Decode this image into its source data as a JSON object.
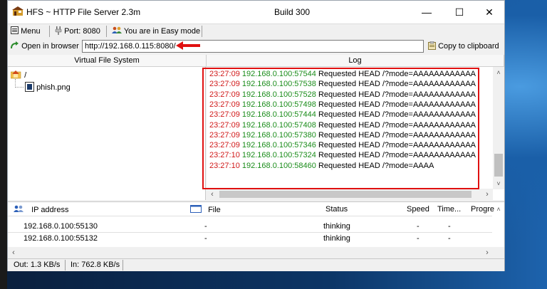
{
  "window": {
    "title": "HFS ~ HTTP File Server 2.3m",
    "build": "Build 300",
    "minimize": "—",
    "maximize": "☐",
    "close": "✕"
  },
  "toolbar": {
    "menu_label": "Menu",
    "port_label": "Port: 8080",
    "mode_label": "You are in Easy mode",
    "open_browser_label": "Open in browser",
    "url_value": "http://192.168.0.115:8080/",
    "copy_label": "Copy to clipboard"
  },
  "vfs": {
    "header": "Virtual File System",
    "root_label": "/",
    "file_label": "phish.png"
  },
  "log": {
    "header": "Log",
    "entries": [
      {
        "time": "23:27:09",
        "ip": "192.168.0.100:57544",
        "msg": "Requested HEAD /?mode=AAAAAAAAAAAA"
      },
      {
        "time": "23:27:09",
        "ip": "192.168.0.100:57538",
        "msg": "Requested HEAD /?mode=AAAAAAAAAAAA"
      },
      {
        "time": "23:27:09",
        "ip": "192.168.0.100:57528",
        "msg": "Requested HEAD /?mode=AAAAAAAAAAAA"
      },
      {
        "time": "23:27:09",
        "ip": "192.168.0.100:57498",
        "msg": "Requested HEAD /?mode=AAAAAAAAAAAA"
      },
      {
        "time": "23:27:09",
        "ip": "192.168.0.100:57444",
        "msg": "Requested HEAD /?mode=AAAAAAAAAAAA"
      },
      {
        "time": "23:27:09",
        "ip": "192.168.0.100:57408",
        "msg": "Requested HEAD /?mode=AAAAAAAAAAAA"
      },
      {
        "time": "23:27:09",
        "ip": "192.168.0.100:57380",
        "msg": "Requested HEAD /?mode=AAAAAAAAAAAA"
      },
      {
        "time": "23:27:09",
        "ip": "192.168.0.100:57346",
        "msg": "Requested HEAD /?mode=AAAAAAAAAAAA"
      },
      {
        "time": "23:27:10",
        "ip": "192.168.0.100:57324",
        "msg": "Requested HEAD /?mode=AAAAAAAAAAAA"
      },
      {
        "time": "23:27:10",
        "ip": "192.168.0.100:58460",
        "msg": "Requested HEAD /?mode=AAAA"
      }
    ]
  },
  "connections": {
    "columns": [
      "IP address",
      "File",
      "Status",
      "Speed",
      "Time...",
      "Progre"
    ],
    "rows": [
      {
        "ip": "192.168.0.100:55130",
        "file": "-",
        "status": "thinking",
        "speed": "-",
        "time": "-"
      },
      {
        "ip": "192.168.0.100:55132",
        "file": "-",
        "status": "thinking",
        "speed": "-",
        "time": "-"
      }
    ]
  },
  "statusbar": {
    "out": "Out: 1.3 KB/s",
    "in": "In: 762.8 KB/s"
  },
  "colors": {
    "log_time": "#d01818",
    "log_ip": "#1a8c1a",
    "highlight_box": "#e01010",
    "arrow": "#e01010"
  }
}
